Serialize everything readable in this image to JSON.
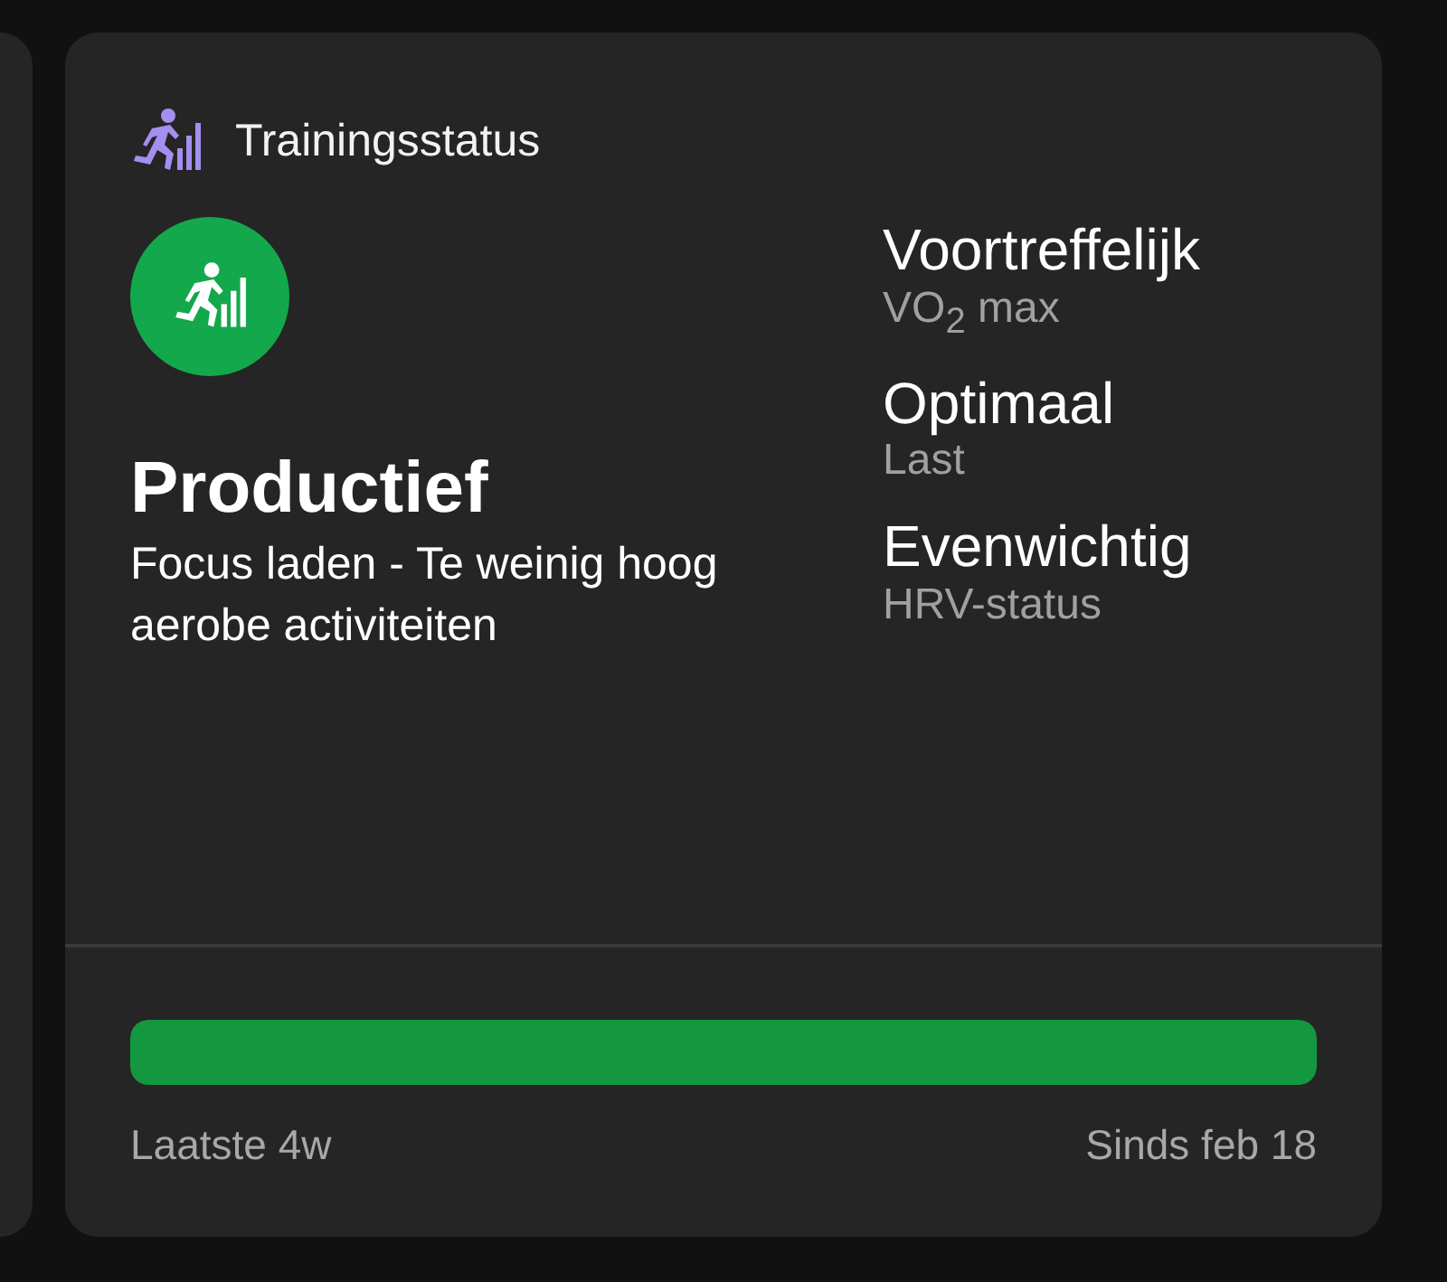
{
  "header": {
    "title": "Trainingsstatus"
  },
  "status": {
    "title": "Productief",
    "description": "Focus laden - Te weinig hoog aerobe activiteiten"
  },
  "metrics": [
    {
      "value": "Voortreffelijk",
      "label": "VO$_{2}$ max"
    },
    {
      "value": "Optimaal",
      "label": "Last"
    },
    {
      "value": "Evenwichtig",
      "label": "HRV-status"
    }
  ],
  "progress": {
    "level": 1,
    "start_label": "Laatste 4w",
    "end_label": "Sinds feb 18"
  }
}
